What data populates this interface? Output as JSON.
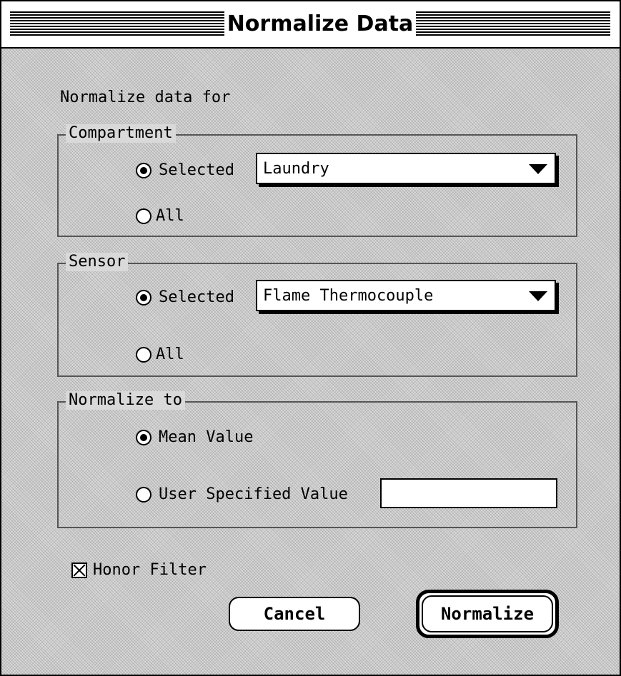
{
  "window": {
    "title": "Normalize Data"
  },
  "intro": "Normalize data for",
  "compartment": {
    "legend": "Compartment",
    "selected_label": "Selected",
    "all_label": "All",
    "selected_value": "Laundry",
    "choice": "selected"
  },
  "sensor": {
    "legend": "Sensor",
    "selected_label": "Selected",
    "all_label": "All",
    "selected_value": "Flame Thermocouple",
    "choice": "selected"
  },
  "normalize_to": {
    "legend": "Normalize to",
    "mean_label": "Mean Value",
    "user_label": "User Specified Value",
    "user_value": "",
    "choice": "mean"
  },
  "honor_filter": {
    "label": "Honor Filter",
    "checked": true
  },
  "buttons": {
    "cancel": "Cancel",
    "normalize": "Normalize"
  }
}
